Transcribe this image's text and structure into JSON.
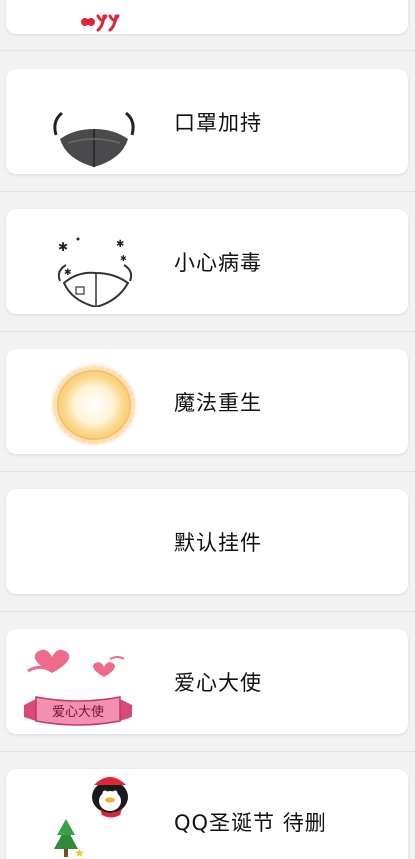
{
  "list": {
    "items": [
      {
        "label": "口罩加持",
        "thumb_icon": "face-mask-icon"
      },
      {
        "label": "小心病毒",
        "thumb_icon": "virus-mask-sketch-icon"
      },
      {
        "label": "魔法重生",
        "thumb_icon": "glowing-orb-icon"
      },
      {
        "label": "默认挂件",
        "thumb_icon": ""
      },
      {
        "label": "爱心大使",
        "thumb_icon": "heart-ribbon-icon",
        "ribbon_text": "爱心大使"
      },
      {
        "label": "QQ圣诞节 待删",
        "thumb_icon": "qq-christmas-icon"
      }
    ]
  },
  "colors": {
    "card_bg": "#ffffff",
    "page_bg": "#f2f2f2",
    "text": "#111111",
    "accent_red": "#e0243a",
    "heart_pink": "#ef6b8a",
    "glow": "#f7c65a"
  }
}
